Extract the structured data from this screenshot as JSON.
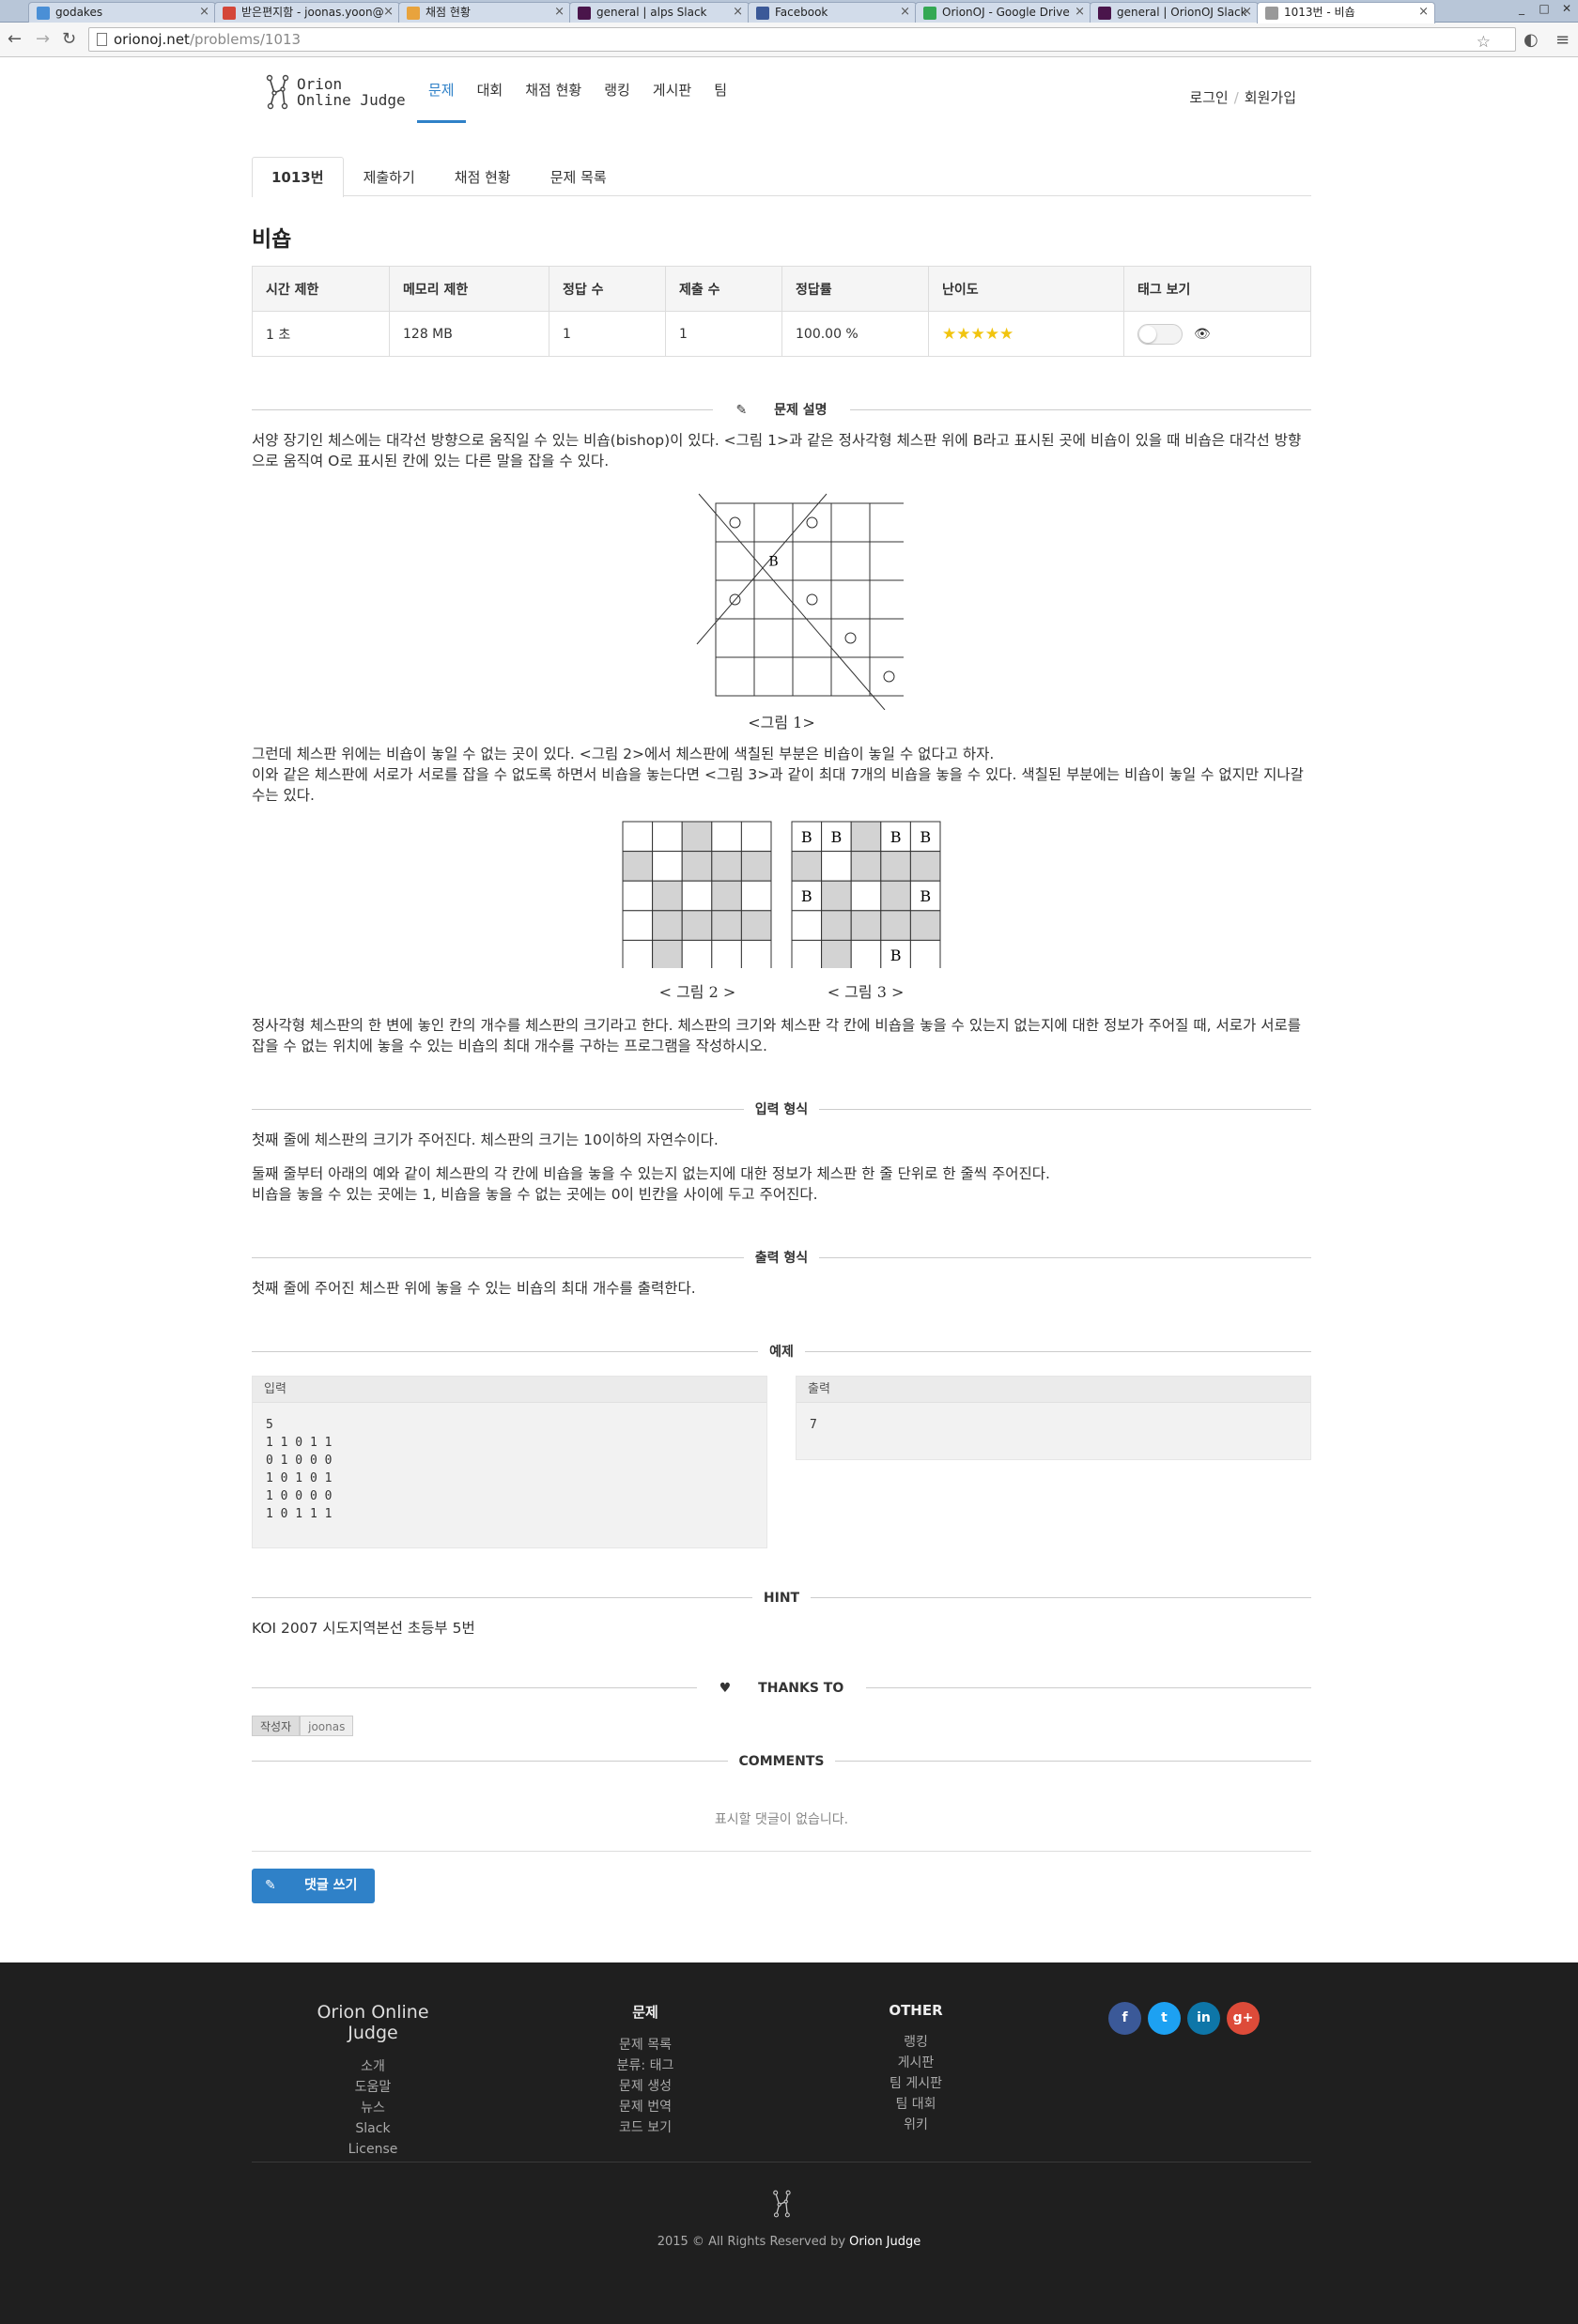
{
  "browser": {
    "tabs": [
      {
        "title": "godakes",
        "color": "#4a8fd6",
        "glyph": "g"
      },
      {
        "title": "받은편지함 - joonas.yoon@",
        "color": "#d44638",
        "glyph": "M"
      },
      {
        "title": "채점 현황",
        "color": "#e8a33d",
        "glyph": "o"
      },
      {
        "title": "general | alps Slack",
        "color": "#4a154b",
        "glyph": "#"
      },
      {
        "title": "Facebook",
        "color": "#3b5998",
        "glyph": "f"
      },
      {
        "title": "OrionOJ - Google Drive",
        "color": "#34a853",
        "glyph": "▲"
      },
      {
        "title": "general | OrionOJ Slack",
        "color": "#4a154b",
        "glyph": "#"
      },
      {
        "title": "1013번 - 비숍",
        "color": "#999999",
        "glyph": ""
      }
    ],
    "url_host": "orionoj.net",
    "url_path": "/problems/1013"
  },
  "header": {
    "logo_line1": "Orion",
    "logo_line2": "Online Judge",
    "nav": [
      "문제",
      "대회",
      "채점 현황",
      "랭킹",
      "게시판",
      "팀"
    ],
    "login": "로그인",
    "signup": "회원가입"
  },
  "subtabs": [
    "1013번",
    "제출하기",
    "채점 현황",
    "문제 목록"
  ],
  "problem": {
    "title": "비숍",
    "headers": [
      "시간 제한",
      "메모리 제한",
      "정답 수",
      "제출 수",
      "정답률",
      "난이도",
      "태그 보기"
    ],
    "values": [
      "1 초",
      "128 MB",
      "1",
      "1",
      "100.00 %"
    ],
    "difficulty_stars": 5,
    "stars_text": "★★★★★"
  },
  "description": {
    "heading": "문제 설명",
    "p1": "서양 장기인 체스에는 대각선 방향으로 움직일 수 있는 비숍(bishop)이 있다. <그림 1>과 같은 정사각형 체스판 위에 B라고 표시된 곳에 비숍이 있을 때 비숍은 대각선 방향으로 움직여 O로 표시된 칸에 있는 다른 말을 잡을 수 있다.",
    "fig1_caption": "<그림 1>",
    "p2": "그런데 체스판 위에는 비숍이 놓일 수 없는 곳이 있다. <그림 2>에서 체스판에 색칠된 부분은 비숍이 놓일 수 없다고 하자.",
    "p3": "이와 같은 체스판에 서로가 서로를 잡을 수 없도록 하면서 비숍을 놓는다면 <그림 3>과 같이 최대 7개의 비숍을 놓을 수 있다.  색칠된 부분에는 비숍이 놓일 수 없지만 지나갈 수는 있다.",
    "fig2_caption": "< 그림 2 >",
    "fig3_caption": "< 그림 3 >",
    "p4": "정사각형 체스판의 한 변에 놓인 칸의 개수를 체스판의 크기라고 한다. 체스판의 크기와 체스판 각 칸에 비숍을 놓을 수 있는지 없는지에 대한 정보가 주어질 때, 서로가 서로를 잡을 수 없는 위치에 놓을 수 있는 비숍의 최대 개수를 구하는 프로그램을 작성하시오."
  },
  "input": {
    "heading": "입력 형식",
    "p1": "첫째 줄에 체스판의 크기가 주어진다. 체스판의 크기는 10이하의 자연수이다.",
    "p2": "둘째 줄부터 아래의 예와 같이 체스판의 각 칸에 비숍을 놓을 수 있는지 없는지에 대한 정보가 체스판 한 줄 단위로 한 줄씩 주어진다.",
    "p3": "비숍을 놓을 수 있는 곳에는 1, 비숍을 놓을 수 없는 곳에는 0이 빈칸을 사이에 두고 주어진다."
  },
  "output": {
    "heading": "출력 형식",
    "p1": "첫째 줄에 주어진 체스판 위에 놓을 수 있는 비숍의 최대 개수를 출력한다."
  },
  "example": {
    "heading": "예제",
    "input_label": "입력",
    "input_text": "5\n1 1 0 1 1\n0 1 0 0 0\n1 0 1 0 1\n1 0 0 0 0\n1 0 1 1 1",
    "output_label": "출력",
    "output_text": "7"
  },
  "hint": {
    "heading": "HINT",
    "text": "KOI 2007 시도지역본선 초등부 5번"
  },
  "thanks": {
    "heading": "THANKS TO",
    "role": "작성자",
    "user": "joonas"
  },
  "comments": {
    "heading": "COMMENTS",
    "empty": "표시할 댓글이 없습니다.",
    "button": "댓글 쓰기"
  },
  "footer": {
    "brand": "Orion Online Judge",
    "col1": [
      "소개",
      "도움말",
      "뉴스",
      "Slack",
      "License"
    ],
    "col2_title": "문제",
    "col2": [
      "문제 목록",
      "분류: 태그",
      "문제 생성",
      "문제 번역",
      "코드 보기"
    ],
    "col3_title": "OTHER",
    "col3": [
      "랭킹",
      "게시판",
      "팀 게시판",
      "팀 대회",
      "위키"
    ],
    "social": [
      {
        "name": "facebook",
        "glyph": "f",
        "color": "#3b5998"
      },
      {
        "name": "twitter",
        "glyph": "t",
        "color": "#1da1f2"
      },
      {
        "name": "linkedin",
        "glyph": "in",
        "color": "#0e76a8"
      },
      {
        "name": "google-plus",
        "glyph": "g+",
        "color": "#dd4b39"
      }
    ],
    "copyright": "2015 © All Rights Reserved by ",
    "copyright_brand": "Orion Judge"
  },
  "colors": {
    "accent": "#2f81c8",
    "footer_bg": "#1f1f1f",
    "star": "#f1c40f"
  }
}
